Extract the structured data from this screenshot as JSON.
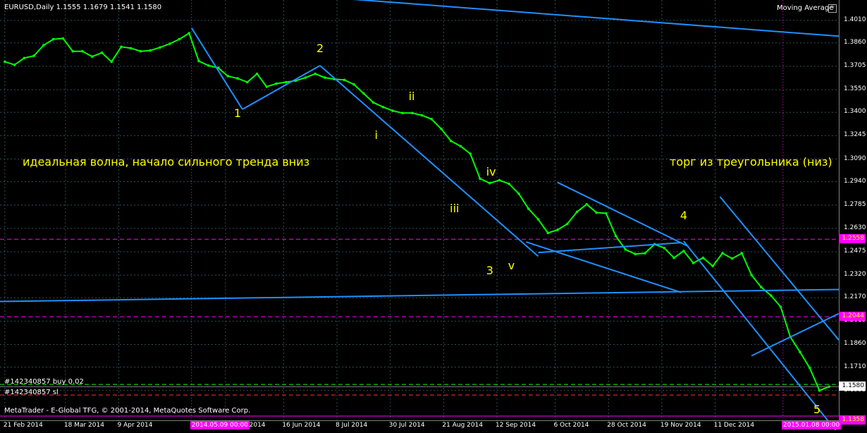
{
  "window": {
    "caption": "EURUSD,Daily  1.1555 1.1679 1.1541 1.1580",
    "indicator_label": "Moving Average",
    "indicator_icon": "gear-icon",
    "copyright": "MetaTrader - E-Global TFG, © 2001-2014, MetaQuotes Software Corp."
  },
  "annotations": {
    "note_left": "идеальная волна, начало сильного тренда вниз",
    "note_right": "торг из треугольника (низ)",
    "waves": [
      {
        "text": "1",
        "date": "2014-05-28",
        "price": 1.339
      },
      {
        "text": "2",
        "date": "2014-07-01",
        "price": 1.382
      },
      {
        "text": "i",
        "date": "2014-07-25",
        "price": 1.3245
      },
      {
        "text": "ii",
        "date": "2014-08-08",
        "price": 1.3505
      },
      {
        "text": "iii",
        "date": "2014-08-25",
        "price": 1.276
      },
      {
        "text": "iv",
        "date": "2014-09-09",
        "price": 1.3005
      },
      {
        "text": "v",
        "date": "2014-09-18",
        "price": 1.238
      },
      {
        "text": "3",
        "date": "2014-09-09",
        "price": 1.235
      },
      {
        "text": "4",
        "date": "2014-11-28",
        "price": 1.2715
      },
      {
        "text": "5",
        "date": "2015-01-22",
        "price": 1.1425
      }
    ]
  },
  "orders": {
    "buy_label": "#142340857 buy 0.02",
    "sl_label": "#142340857 sl"
  },
  "colors": {
    "background": "#000000",
    "candles": "#00ff00",
    "trendline": "#1e90ff",
    "level": "#ff00ff",
    "label": "#ffff00",
    "grid": "#2f4f4f"
  },
  "chart_data": {
    "type": "line",
    "series": [
      {
        "values": [
          [
            "2014-02-21",
            1.3735
          ],
          [
            "2014-02-25",
            1.3715
          ],
          [
            "2014-03-01",
            1.376
          ],
          [
            "2014-03-05",
            1.3775
          ],
          [
            "2014-03-09",
            1.3845
          ],
          [
            "2014-03-13",
            1.3885
          ],
          [
            "2014-03-17",
            1.389
          ],
          [
            "2014-03-21",
            1.3805
          ],
          [
            "2014-03-25",
            1.3805
          ],
          [
            "2014-03-29",
            1.377
          ],
          [
            "2014-04-02",
            1.3795
          ],
          [
            "2014-04-06",
            1.3735
          ],
          [
            "2014-04-10",
            1.3835
          ],
          [
            "2014-04-14",
            1.3825
          ],
          [
            "2014-04-18",
            1.3805
          ],
          [
            "2014-04-22",
            1.381
          ],
          [
            "2014-04-26",
            1.383
          ],
          [
            "2014-04-30",
            1.3855
          ],
          [
            "2014-05-04",
            1.3885
          ],
          [
            "2014-05-08",
            1.3925
          ],
          [
            "2014-05-12",
            1.374
          ],
          [
            "2014-05-16",
            1.371
          ],
          [
            "2014-05-20",
            1.3695
          ],
          [
            "2014-05-24",
            1.364
          ],
          [
            "2014-05-28",
            1.3625
          ],
          [
            "2014-06-01",
            1.36
          ],
          [
            "2014-06-05",
            1.3655
          ],
          [
            "2014-06-09",
            1.357
          ],
          [
            "2014-06-13",
            1.359
          ],
          [
            "2014-06-17",
            1.36
          ],
          [
            "2014-06-21",
            1.361
          ],
          [
            "2014-06-25",
            1.363
          ],
          [
            "2014-06-29",
            1.3655
          ],
          [
            "2014-07-03",
            1.363
          ],
          [
            "2014-07-07",
            1.362
          ],
          [
            "2014-07-11",
            1.3615
          ],
          [
            "2014-07-15",
            1.3585
          ],
          [
            "2014-07-19",
            1.3525
          ],
          [
            "2014-07-23",
            1.3465
          ],
          [
            "2014-07-27",
            1.3435
          ],
          [
            "2014-07-31",
            1.341
          ],
          [
            "2014-08-04",
            1.3395
          ],
          [
            "2014-08-08",
            1.3395
          ],
          [
            "2014-08-12",
            1.338
          ],
          [
            "2014-08-16",
            1.3355
          ],
          [
            "2014-08-20",
            1.329
          ],
          [
            "2014-08-24",
            1.321
          ],
          [
            "2014-08-28",
            1.3175
          ],
          [
            "2014-09-01",
            1.3125
          ],
          [
            "2014-09-05",
            1.296
          ],
          [
            "2014-09-09",
            1.293
          ],
          [
            "2014-09-13",
            1.295
          ],
          [
            "2014-09-17",
            1.2925
          ],
          [
            "2014-09-21",
            1.286
          ],
          [
            "2014-09-25",
            1.276
          ],
          [
            "2014-09-29",
            1.269
          ],
          [
            "2014-10-03",
            1.26
          ],
          [
            "2014-10-07",
            1.262
          ],
          [
            "2014-10-11",
            1.266
          ],
          [
            "2014-10-15",
            1.274
          ],
          [
            "2014-10-19",
            1.279
          ],
          [
            "2014-10-23",
            1.2735
          ],
          [
            "2014-10-27",
            1.273
          ],
          [
            "2014-10-31",
            1.258
          ],
          [
            "2014-11-04",
            1.249
          ],
          [
            "2014-11-08",
            1.246
          ],
          [
            "2014-11-12",
            1.2465
          ],
          [
            "2014-11-16",
            1.2525
          ],
          [
            "2014-11-20",
            1.25
          ],
          [
            "2014-11-24",
            1.2435
          ],
          [
            "2014-11-28",
            1.248
          ],
          [
            "2014-12-02",
            1.24
          ],
          [
            "2014-12-06",
            1.2435
          ],
          [
            "2014-12-10",
            1.238
          ],
          [
            "2014-12-14",
            1.2465
          ],
          [
            "2014-12-18",
            1.243
          ],
          [
            "2014-12-22",
            1.2465
          ],
          [
            "2014-12-26",
            1.232
          ],
          [
            "2014-12-30",
            1.224
          ],
          [
            "2015-01-03",
            1.2185
          ],
          [
            "2015-01-07",
            1.211
          ],
          [
            "2015-01-11",
            1.191
          ],
          [
            "2015-01-15",
            1.181
          ],
          [
            "2015-01-19",
            1.1705
          ],
          [
            "2015-01-23",
            1.1555
          ],
          [
            "2015-01-27",
            1.158
          ]
        ]
      }
    ],
    "y_ticks": [
      "1.4010",
      "1.3860",
      "1.3705",
      "1.3550",
      "1.3400",
      "1.3245",
      "1.3090",
      "1.2940",
      "1.2785",
      "1.2630",
      "1.2475",
      "1.2320",
      "1.2170",
      "1.2015",
      "1.1860",
      "1.1710",
      "1.1555"
    ],
    "ylim": [
      1.1357,
      1.4145
    ],
    "x_range": [
      "2014-02-19",
      "2015-01-31"
    ],
    "x_ticks": [
      {
        "date": "2014-02-21",
        "label": "21 Feb 2014"
      },
      {
        "date": "2014-03-18",
        "label": "18 Mar 2014"
      },
      {
        "date": "2014-04-09",
        "label": "9 Apr 2014"
      },
      {
        "date": "2014-05-23",
        "label": "23 May 2014"
      },
      {
        "date": "2014-06-16",
        "label": "16 Jun 2014"
      },
      {
        "date": "2014-07-08",
        "label": "8 Jul 2014"
      },
      {
        "date": "2014-07-30",
        "label": "30 Jul 2014"
      },
      {
        "date": "2014-08-21",
        "label": "21 Aug 2014"
      },
      {
        "date": "2014-09-12",
        "label": "12 Sep 2014"
      },
      {
        "date": "2014-10-06",
        "label": "6 Oct 2014"
      },
      {
        "date": "2014-10-28",
        "label": "28 Oct 2014"
      },
      {
        "date": "2014-11-19",
        "label": "19 Nov 2014"
      },
      {
        "date": "2014-12-11",
        "label": "11 Dec 2014"
      }
    ],
    "time_markers": [
      {
        "date": "2014-05-09",
        "label": "2014.05.09 00:00"
      },
      {
        "date": "2015-01-08",
        "label": "2015.01.08 00:00"
      }
    ],
    "price_labels": [
      {
        "price": 1.2558,
        "label": "1.2558",
        "kind": "level"
      },
      {
        "price": 1.2044,
        "label": "1.2044",
        "kind": "level"
      },
      {
        "price": 1.158,
        "label": "1.1580",
        "kind": "bid"
      },
      {
        "price": 1.1358,
        "label": "1.1358",
        "kind": "level"
      }
    ],
    "levels": [
      {
        "price": 1.2558,
        "style": "dashed"
      },
      {
        "price": 1.2044,
        "style": "dashed"
      },
      {
        "price": 1.1385,
        "style": "solid"
      },
      {
        "price": 1.1525,
        "style": "dashed"
      }
    ],
    "trendlines": [
      {
        "from": [
          "2014-07-06",
          1.416
        ],
        "to": [
          "2015-01-31",
          1.3905
        ]
      },
      {
        "from": [
          "2014-02-19",
          1.2145
        ],
        "to": [
          "2015-01-31",
          1.2225
        ]
      },
      {
        "from": [
          "2014-05-09",
          1.396
        ],
        "to": [
          "2014-05-30",
          1.342
        ]
      },
      {
        "from": [
          "2014-05-30",
          1.342
        ],
        "to": [
          "2014-07-01",
          1.371
        ]
      },
      {
        "from": [
          "2014-07-01",
          1.371
        ],
        "to": [
          "2014-09-29",
          1.2445
        ]
      },
      {
        "from": [
          "2014-09-24",
          1.254
        ],
        "to": [
          "2014-11-27",
          1.2205
        ]
      },
      {
        "from": [
          "2014-09-29",
          1.247
        ],
        "to": [
          "2014-11-27",
          1.2535
        ]
      },
      {
        "from": [
          "2014-10-07",
          1.2935
        ],
        "to": [
          "2014-11-30",
          1.251
        ]
      },
      {
        "from": [
          "2014-11-28",
          1.2545
        ],
        "to": [
          "2015-01-31",
          1.1265
        ]
      },
      {
        "from": [
          "2014-12-13",
          1.284
        ],
        "to": [
          "2015-01-31",
          1.189
        ]
      },
      {
        "from": [
          "2014-12-26",
          1.1785
        ],
        "to": [
          "2015-01-31",
          1.2065
        ]
      }
    ]
  }
}
